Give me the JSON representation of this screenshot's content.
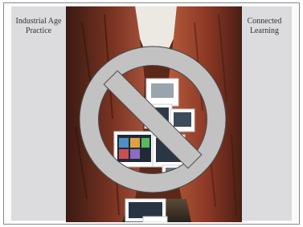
{
  "slide": {
    "left_panel": {
      "line1": "Industrial Age",
      "line2": "Practice"
    },
    "right_panel": {
      "line1": "Connected",
      "line2": "Learning"
    },
    "photo_subject": "canyon-with-stacked-device-photos",
    "overlay_icon": "prohibition-icon",
    "colors": {
      "panel": "#dcdcdf",
      "sign_fill": "#c2c2c2",
      "sign_stroke": "#4a4a4a",
      "rock": "#8a3a24",
      "sky": "#e8e4df"
    }
  }
}
